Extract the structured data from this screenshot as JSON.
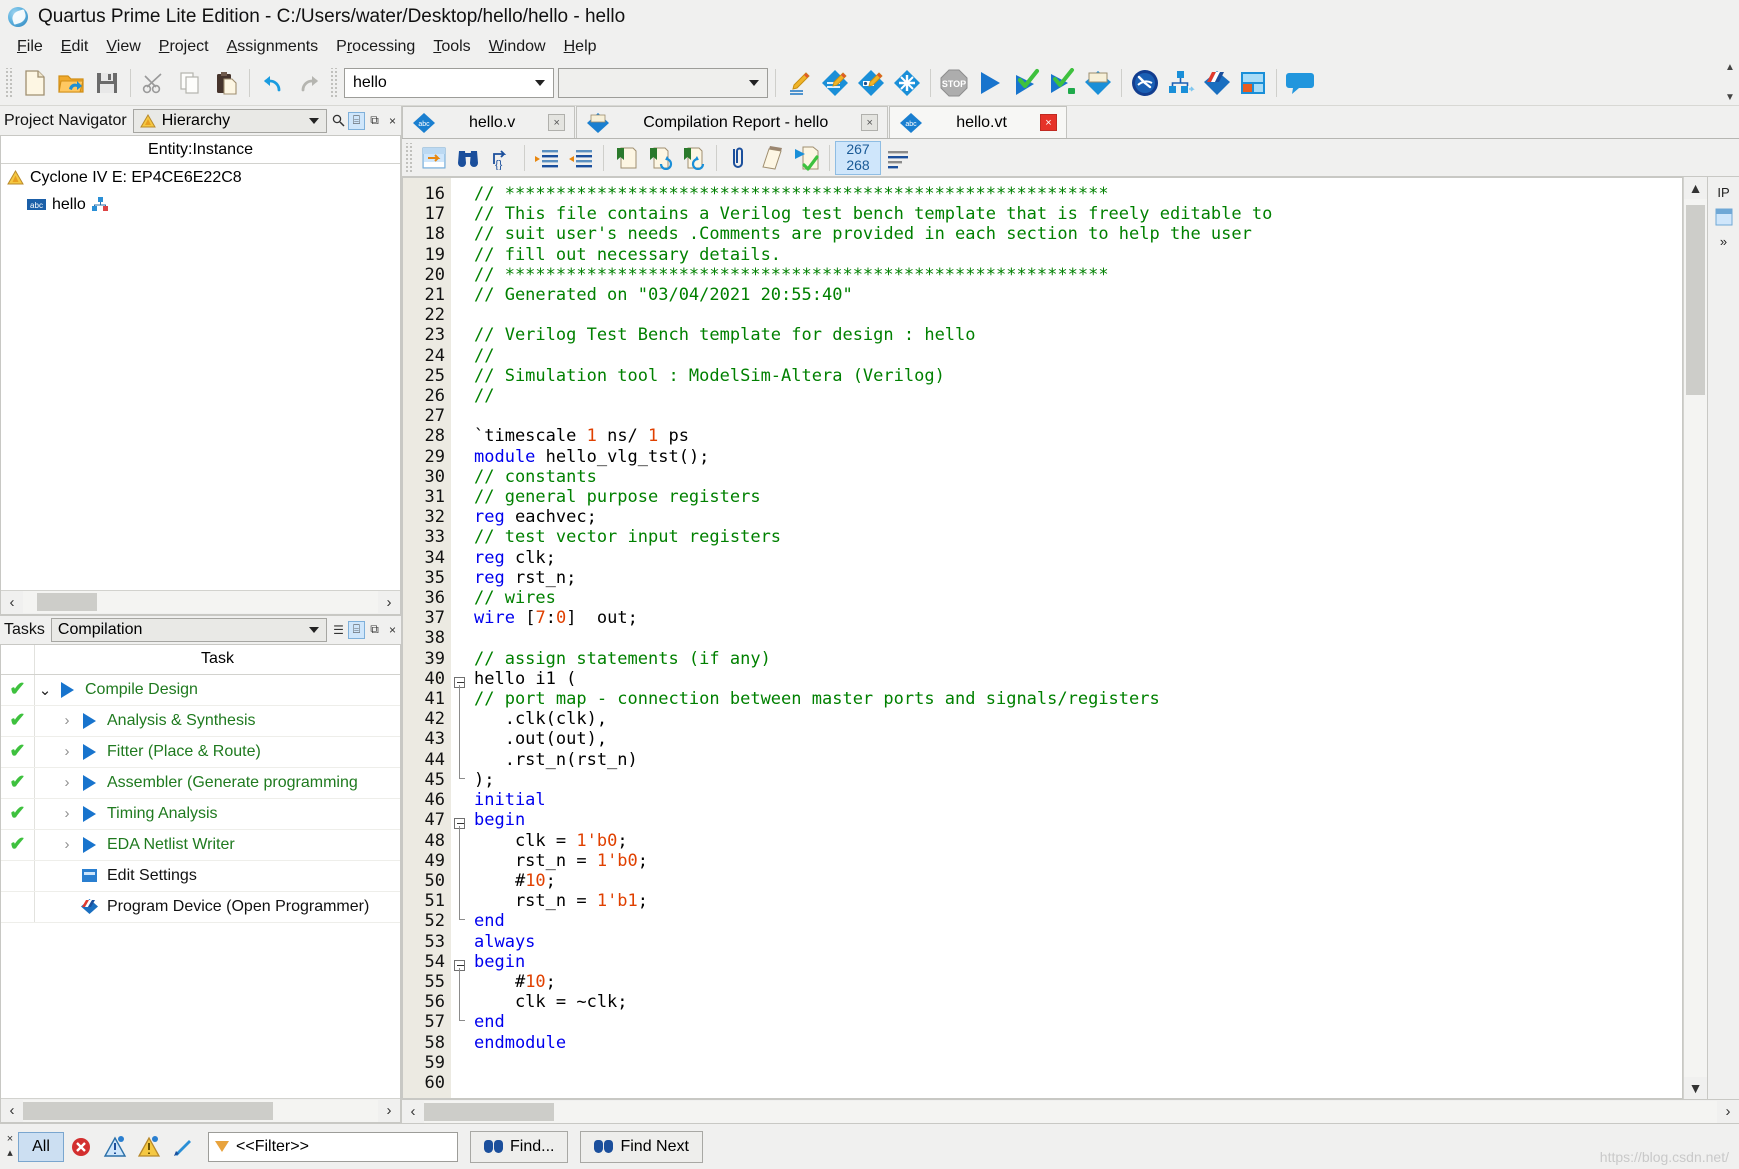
{
  "window": {
    "title": "Quartus Prime Lite Edition - C:/Users/water/Desktop/hello/hello - hello",
    "icon": "quartus-globe-icon"
  },
  "menubar": {
    "items": [
      {
        "label": "File",
        "accel": "F"
      },
      {
        "label": "Edit",
        "accel": "E"
      },
      {
        "label": "View",
        "accel": "V"
      },
      {
        "label": "Project",
        "accel": "P"
      },
      {
        "label": "Assignments",
        "accel": "A"
      },
      {
        "label": "Processing",
        "accel": "c"
      },
      {
        "label": "Tools",
        "accel": "T"
      },
      {
        "label": "Window",
        "accel": "W"
      },
      {
        "label": "Help",
        "accel": "H"
      }
    ]
  },
  "toolbar": {
    "buttons": [
      {
        "name": "new-file-icon",
        "title": "New"
      },
      {
        "name": "open-folder-icon",
        "title": "Open"
      },
      {
        "name": "save-icon",
        "title": "Save"
      },
      {
        "name": "cut-scissors-icon",
        "title": "Cut"
      },
      {
        "name": "copy-icon",
        "title": "Copy"
      },
      {
        "name": "paste-icon",
        "title": "Paste"
      },
      {
        "name": "undo-icon",
        "title": "Undo"
      },
      {
        "name": "redo-icon",
        "title": "Redo"
      }
    ],
    "project_combo": {
      "value": "hello",
      "name": "project-selector"
    },
    "revision_combo": {
      "value": "",
      "name": "revision-selector"
    },
    "action_buttons": [
      {
        "name": "edit-pencil-icon",
        "title": "Settings"
      },
      {
        "name": "assignment-editor-icon",
        "title": "Assignment Editor"
      },
      {
        "name": "pin-planner-icon",
        "title": "Pin Planner"
      },
      {
        "name": "device-icon",
        "title": "Device"
      },
      {
        "name": "stop-icon",
        "title": "Stop Processing"
      },
      {
        "name": "start-compilation-icon",
        "title": "Start Compilation"
      },
      {
        "name": "start-analysis-synthesis-icon",
        "title": "Start Analysis & Synthesis"
      },
      {
        "name": "start-compilation-check-icon",
        "title": "Analysis & Elaboration"
      },
      {
        "name": "compilation-report-icon",
        "title": "Compilation Report"
      },
      {
        "name": "timing-analyzer-icon",
        "title": "Timing Analyzer"
      },
      {
        "name": "netlist-viewer-icon",
        "title": "RTL Viewer"
      },
      {
        "name": "programmer-icon",
        "title": "Programmer"
      },
      {
        "name": "signal-tap-icon",
        "title": "Signal Tap"
      },
      {
        "name": "help-bubble-icon",
        "title": "Help"
      }
    ]
  },
  "project_navigator": {
    "panel_title": "Project Navigator",
    "view_selector": "Hierarchy",
    "view_icon": "hierarchy-triangle-icon",
    "column_header": "Entity:Instance",
    "rows": [
      {
        "label": "Cyclone IV E: EP4CE6E22C8",
        "icon": "device-warning-icon",
        "indent": false
      },
      {
        "label": "hello",
        "icon": "abc-verilog-icon",
        "indent": true,
        "badge": "hierarchy-badge-icon"
      }
    ],
    "panel_buttons": [
      "search-icon",
      "pin-icon",
      "undock-icon",
      "close-icon"
    ]
  },
  "tasks": {
    "panel_title": "Tasks",
    "flow_selector": "Compilation",
    "column_header": "Task",
    "panel_buttons": [
      "list-icon",
      "pin-icon",
      "undock-icon",
      "close-icon"
    ],
    "rows": [
      {
        "label": "Compile Design",
        "status": "done",
        "expander": "down",
        "play": true,
        "level": 0,
        "green": true
      },
      {
        "label": "Analysis & Synthesis",
        "status": "done",
        "expander": "right",
        "play": true,
        "level": 1,
        "green": true
      },
      {
        "label": "Fitter (Place & Route)",
        "status": "done",
        "expander": "right",
        "play": true,
        "level": 1,
        "green": true
      },
      {
        "label": "Assembler (Generate programming",
        "status": "done",
        "expander": "right",
        "play": true,
        "level": 1,
        "green": true
      },
      {
        "label": "Timing Analysis",
        "status": "done",
        "expander": "right",
        "play": true,
        "level": 1,
        "green": true
      },
      {
        "label": "EDA Netlist Writer",
        "status": "done",
        "expander": "right",
        "play": true,
        "level": 1,
        "green": true
      },
      {
        "label": "Edit Settings",
        "status": "none",
        "expander": "none",
        "play": false,
        "level": 1,
        "green": false,
        "icon": "settings-square-icon"
      },
      {
        "label": "Program Device (Open Programmer)",
        "status": "none",
        "expander": "none",
        "play": false,
        "level": 1,
        "green": false,
        "icon": "programmer-small-icon"
      }
    ]
  },
  "editor": {
    "tabs": [
      {
        "label": "hello.v",
        "icon": "abc-verilog-icon",
        "active": false,
        "close": "grey"
      },
      {
        "label": "Compilation Report - hello",
        "icon": "report-icon",
        "active": false,
        "close": "grey"
      },
      {
        "label": "hello.vt",
        "icon": "abc-verilog-icon",
        "active": true,
        "close": "red"
      }
    ],
    "toolbar_buttons": [
      {
        "name": "insert-template-icon"
      },
      {
        "name": "find-binoculars-icon"
      },
      {
        "name": "goto-line-icon"
      },
      {
        "name": "increase-indent-icon"
      },
      {
        "name": "decrease-indent-icon"
      },
      {
        "name": "bookmark-toggle-icon"
      },
      {
        "name": "bookmark-next-icon"
      },
      {
        "name": "bookmark-prev-icon"
      },
      {
        "name": "comment-clip-icon"
      },
      {
        "name": "uncomment-icon"
      },
      {
        "name": "run-check-icon"
      },
      {
        "name": "line-numbers-icon"
      }
    ],
    "line_badge": {
      "top": "267",
      "bottom": "268"
    },
    "first_line_number": 16,
    "lines": [
      {
        "n": 16,
        "fold": "none",
        "tokens": [
          {
            "t": "// ***********************************************************",
            "c": "cm"
          }
        ]
      },
      {
        "n": 17,
        "fold": "none",
        "tokens": [
          {
            "t": "// This file contains a Verilog test bench template that is freely editable to",
            "c": "cm"
          }
        ]
      },
      {
        "n": 18,
        "fold": "none",
        "tokens": [
          {
            "t": "// suit user's needs .Comments are provided in each section to help the user",
            "c": "cm"
          }
        ]
      },
      {
        "n": 19,
        "fold": "none",
        "tokens": [
          {
            "t": "// fill out necessary details.",
            "c": "cm"
          }
        ]
      },
      {
        "n": 20,
        "fold": "none",
        "tokens": [
          {
            "t": "// ***********************************************************",
            "c": "cm"
          }
        ]
      },
      {
        "n": 21,
        "fold": "none",
        "tokens": [
          {
            "t": "// Generated on \"03/04/2021 20:55:40\"",
            "c": "cm"
          }
        ]
      },
      {
        "n": 22,
        "fold": "none",
        "tokens": []
      },
      {
        "n": 23,
        "fold": "none",
        "tokens": [
          {
            "t": "// Verilog Test Bench template for design : hello",
            "c": "cm"
          }
        ]
      },
      {
        "n": 24,
        "fold": "none",
        "tokens": [
          {
            "t": "//",
            "c": "cm"
          }
        ]
      },
      {
        "n": 25,
        "fold": "none",
        "tokens": [
          {
            "t": "// Simulation tool : ModelSim-Altera (Verilog)",
            "c": "cm"
          }
        ]
      },
      {
        "n": 26,
        "fold": "none",
        "tokens": [
          {
            "t": "//",
            "c": "cm"
          }
        ]
      },
      {
        "n": 27,
        "fold": "none",
        "tokens": []
      },
      {
        "n": 28,
        "fold": "none",
        "tokens": [
          {
            "t": "`timescale ",
            "c": ""
          },
          {
            "t": "1",
            "c": "num"
          },
          {
            "t": " ns/ ",
            "c": ""
          },
          {
            "t": "1",
            "c": "num"
          },
          {
            "t": " ps",
            "c": ""
          }
        ]
      },
      {
        "n": 29,
        "fold": "none",
        "tokens": [
          {
            "t": "module",
            "c": "kw"
          },
          {
            "t": " hello_vlg_tst();",
            "c": ""
          }
        ]
      },
      {
        "n": 30,
        "fold": "none",
        "tokens": [
          {
            "t": "// constants",
            "c": "cm"
          }
        ]
      },
      {
        "n": 31,
        "fold": "none",
        "tokens": [
          {
            "t": "// general purpose registers",
            "c": "cm"
          }
        ]
      },
      {
        "n": 32,
        "fold": "none",
        "tokens": [
          {
            "t": "reg",
            "c": "kw"
          },
          {
            "t": " eachvec;",
            "c": ""
          }
        ]
      },
      {
        "n": 33,
        "fold": "none",
        "tokens": [
          {
            "t": "// test vector input registers",
            "c": "cm"
          }
        ]
      },
      {
        "n": 34,
        "fold": "none",
        "tokens": [
          {
            "t": "reg",
            "c": "kw"
          },
          {
            "t": " clk;",
            "c": ""
          }
        ]
      },
      {
        "n": 35,
        "fold": "none",
        "tokens": [
          {
            "t": "reg",
            "c": "kw"
          },
          {
            "t": " rst_n;",
            "c": ""
          }
        ]
      },
      {
        "n": 36,
        "fold": "none",
        "tokens": [
          {
            "t": "// wires",
            "c": "cm"
          }
        ]
      },
      {
        "n": 37,
        "fold": "none",
        "tokens": [
          {
            "t": "wire",
            "c": "kw"
          },
          {
            "t": " [",
            "c": ""
          },
          {
            "t": "7",
            "c": "num"
          },
          {
            "t": ":",
            "c": ""
          },
          {
            "t": "0",
            "c": "num"
          },
          {
            "t": "]  out;",
            "c": ""
          }
        ]
      },
      {
        "n": 38,
        "fold": "none",
        "tokens": []
      },
      {
        "n": 39,
        "fold": "none",
        "tokens": [
          {
            "t": "// assign statements (if any)",
            "c": "cm"
          }
        ]
      },
      {
        "n": 40,
        "fold": "start",
        "tokens": [
          {
            "t": "hello i1 (",
            "c": ""
          }
        ]
      },
      {
        "n": 41,
        "fold": "mid",
        "tokens": [
          {
            "t": "// port map - connection between master ports and signals/registers",
            "c": "cm"
          }
        ]
      },
      {
        "n": 42,
        "fold": "mid",
        "tokens": [
          {
            "t": "   .clk(clk),",
            "c": ""
          }
        ]
      },
      {
        "n": 43,
        "fold": "mid",
        "tokens": [
          {
            "t": "   .out(out),",
            "c": ""
          }
        ]
      },
      {
        "n": 44,
        "fold": "mid",
        "tokens": [
          {
            "t": "   .rst_n(rst_n)",
            "c": ""
          }
        ]
      },
      {
        "n": 45,
        "fold": "end",
        "tokens": [
          {
            "t": ");",
            "c": ""
          }
        ]
      },
      {
        "n": 46,
        "fold": "none",
        "tokens": [
          {
            "t": "initial",
            "c": "kw"
          }
        ]
      },
      {
        "n": 47,
        "fold": "start",
        "tokens": [
          {
            "t": "begin",
            "c": "kw"
          }
        ]
      },
      {
        "n": 48,
        "fold": "mid",
        "tokens": [
          {
            "t": "    clk = ",
            "c": ""
          },
          {
            "t": "1'b0",
            "c": "num"
          },
          {
            "t": ";",
            "c": ""
          }
        ]
      },
      {
        "n": 49,
        "fold": "mid",
        "tokens": [
          {
            "t": "    rst_n = ",
            "c": ""
          },
          {
            "t": "1'b0",
            "c": "num"
          },
          {
            "t": ";",
            "c": ""
          }
        ]
      },
      {
        "n": 50,
        "fold": "mid",
        "tokens": [
          {
            "t": "    #",
            "c": ""
          },
          {
            "t": "10",
            "c": "num"
          },
          {
            "t": ";",
            "c": ""
          }
        ]
      },
      {
        "n": 51,
        "fold": "mid",
        "tokens": [
          {
            "t": "    rst_n = ",
            "c": ""
          },
          {
            "t": "1'b1",
            "c": "num"
          },
          {
            "t": ";",
            "c": ""
          }
        ]
      },
      {
        "n": 52,
        "fold": "end",
        "tokens": [
          {
            "t": "end",
            "c": "kw"
          }
        ]
      },
      {
        "n": 53,
        "fold": "none",
        "tokens": [
          {
            "t": "always",
            "c": "kw"
          }
        ]
      },
      {
        "n": 54,
        "fold": "start",
        "tokens": [
          {
            "t": "begin",
            "c": "kw"
          }
        ]
      },
      {
        "n": 55,
        "fold": "mid",
        "tokens": [
          {
            "t": "    #",
            "c": ""
          },
          {
            "t": "10",
            "c": "num"
          },
          {
            "t": ";",
            "c": ""
          }
        ]
      },
      {
        "n": 56,
        "fold": "mid",
        "tokens": [
          {
            "t": "    clk = ~clk;",
            "c": ""
          }
        ]
      },
      {
        "n": 57,
        "fold": "end",
        "tokens": [
          {
            "t": "end",
            "c": "kw"
          }
        ]
      },
      {
        "n": 58,
        "fold": "none",
        "tokens": [
          {
            "t": "endmodule",
            "c": "kw"
          }
        ]
      },
      {
        "n": 59,
        "fold": "none",
        "tokens": []
      },
      {
        "n": 60,
        "fold": "none",
        "tokens": []
      }
    ]
  },
  "dock_right": {
    "label": "IP",
    "items": [
      "ip-catalog-icon",
      "expand-icon"
    ]
  },
  "statusbar": {
    "all_button": "All",
    "message_icons": [
      "error-icon",
      "critical-warning-icon",
      "warning-icon",
      "info-icon"
    ],
    "filter_placeholder": "<<Filter>>",
    "find_button": "Find...",
    "find_next_button": "Find Next",
    "watermark": "https://blog.csdn.net/"
  },
  "colors": {
    "accent_blue": "#1874cd",
    "comment_green": "#008000",
    "keyword_blue": "#0000ee",
    "number_red": "#e04000",
    "task_green": "#1f7a1f",
    "badge_blue": "#cfe6fb",
    "chrome": "#f0f0ef"
  }
}
